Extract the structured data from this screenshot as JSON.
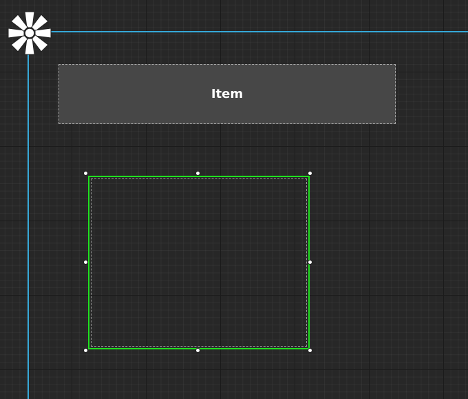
{
  "item": {
    "label": "Item"
  },
  "colors": {
    "guide": "#35a8d8",
    "selection": "#1fe01f",
    "item_fill": "#474747",
    "background": "#272727"
  },
  "icons": {
    "pivot": "pivot-star-icon",
    "handle": "resize-handle-icon"
  }
}
